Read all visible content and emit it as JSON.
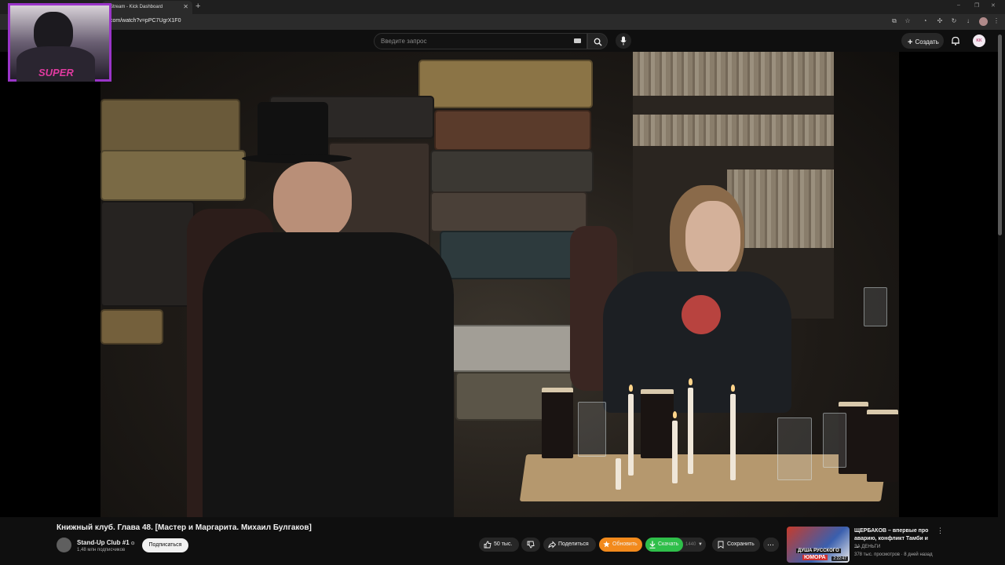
{
  "browser": {
    "tab_title": "Stream - Kick Dashboard",
    "url": "com/watch?v=pPC7UgrX1F0"
  },
  "header": {
    "search_placeholder": "Введите запрос",
    "create_label": "Создать",
    "avatar_initials": "KK"
  },
  "video": {
    "title": "Книжный клуб. Глава 48. [Мастер и Маргарита. Михаил Булгаков]",
    "channel": {
      "name": "Stand-Up Club #1",
      "subscribers": "1,48 млн подписчиков",
      "subscribe_label": "Подписаться"
    },
    "actions": {
      "likes": "50 тыс.",
      "share_label": "Поделиться",
      "update_label": "Обновить",
      "download_label": "Скачать",
      "download_quality": "1440",
      "save_label": "Сохранить",
      "more_label": "..."
    }
  },
  "webcam": {
    "logo_text": "SUPER"
  },
  "recommendation": {
    "title": "ЩЕРБАКОВ – впервые про аварию, конфликт Тамби и ...",
    "channel": "ЗА ДЕНЬГИ",
    "meta": "378 тыс. просмотров · 8 дней назад",
    "duration": "2:22:47",
    "thumb_line1": "ДУША РУССКОГО",
    "thumb_line2": "ЮМОРА"
  },
  "colors": {
    "update_btn": "#f28a1c",
    "download_btn": "#2fbf4a",
    "webcam_border": "#9a35c8"
  }
}
